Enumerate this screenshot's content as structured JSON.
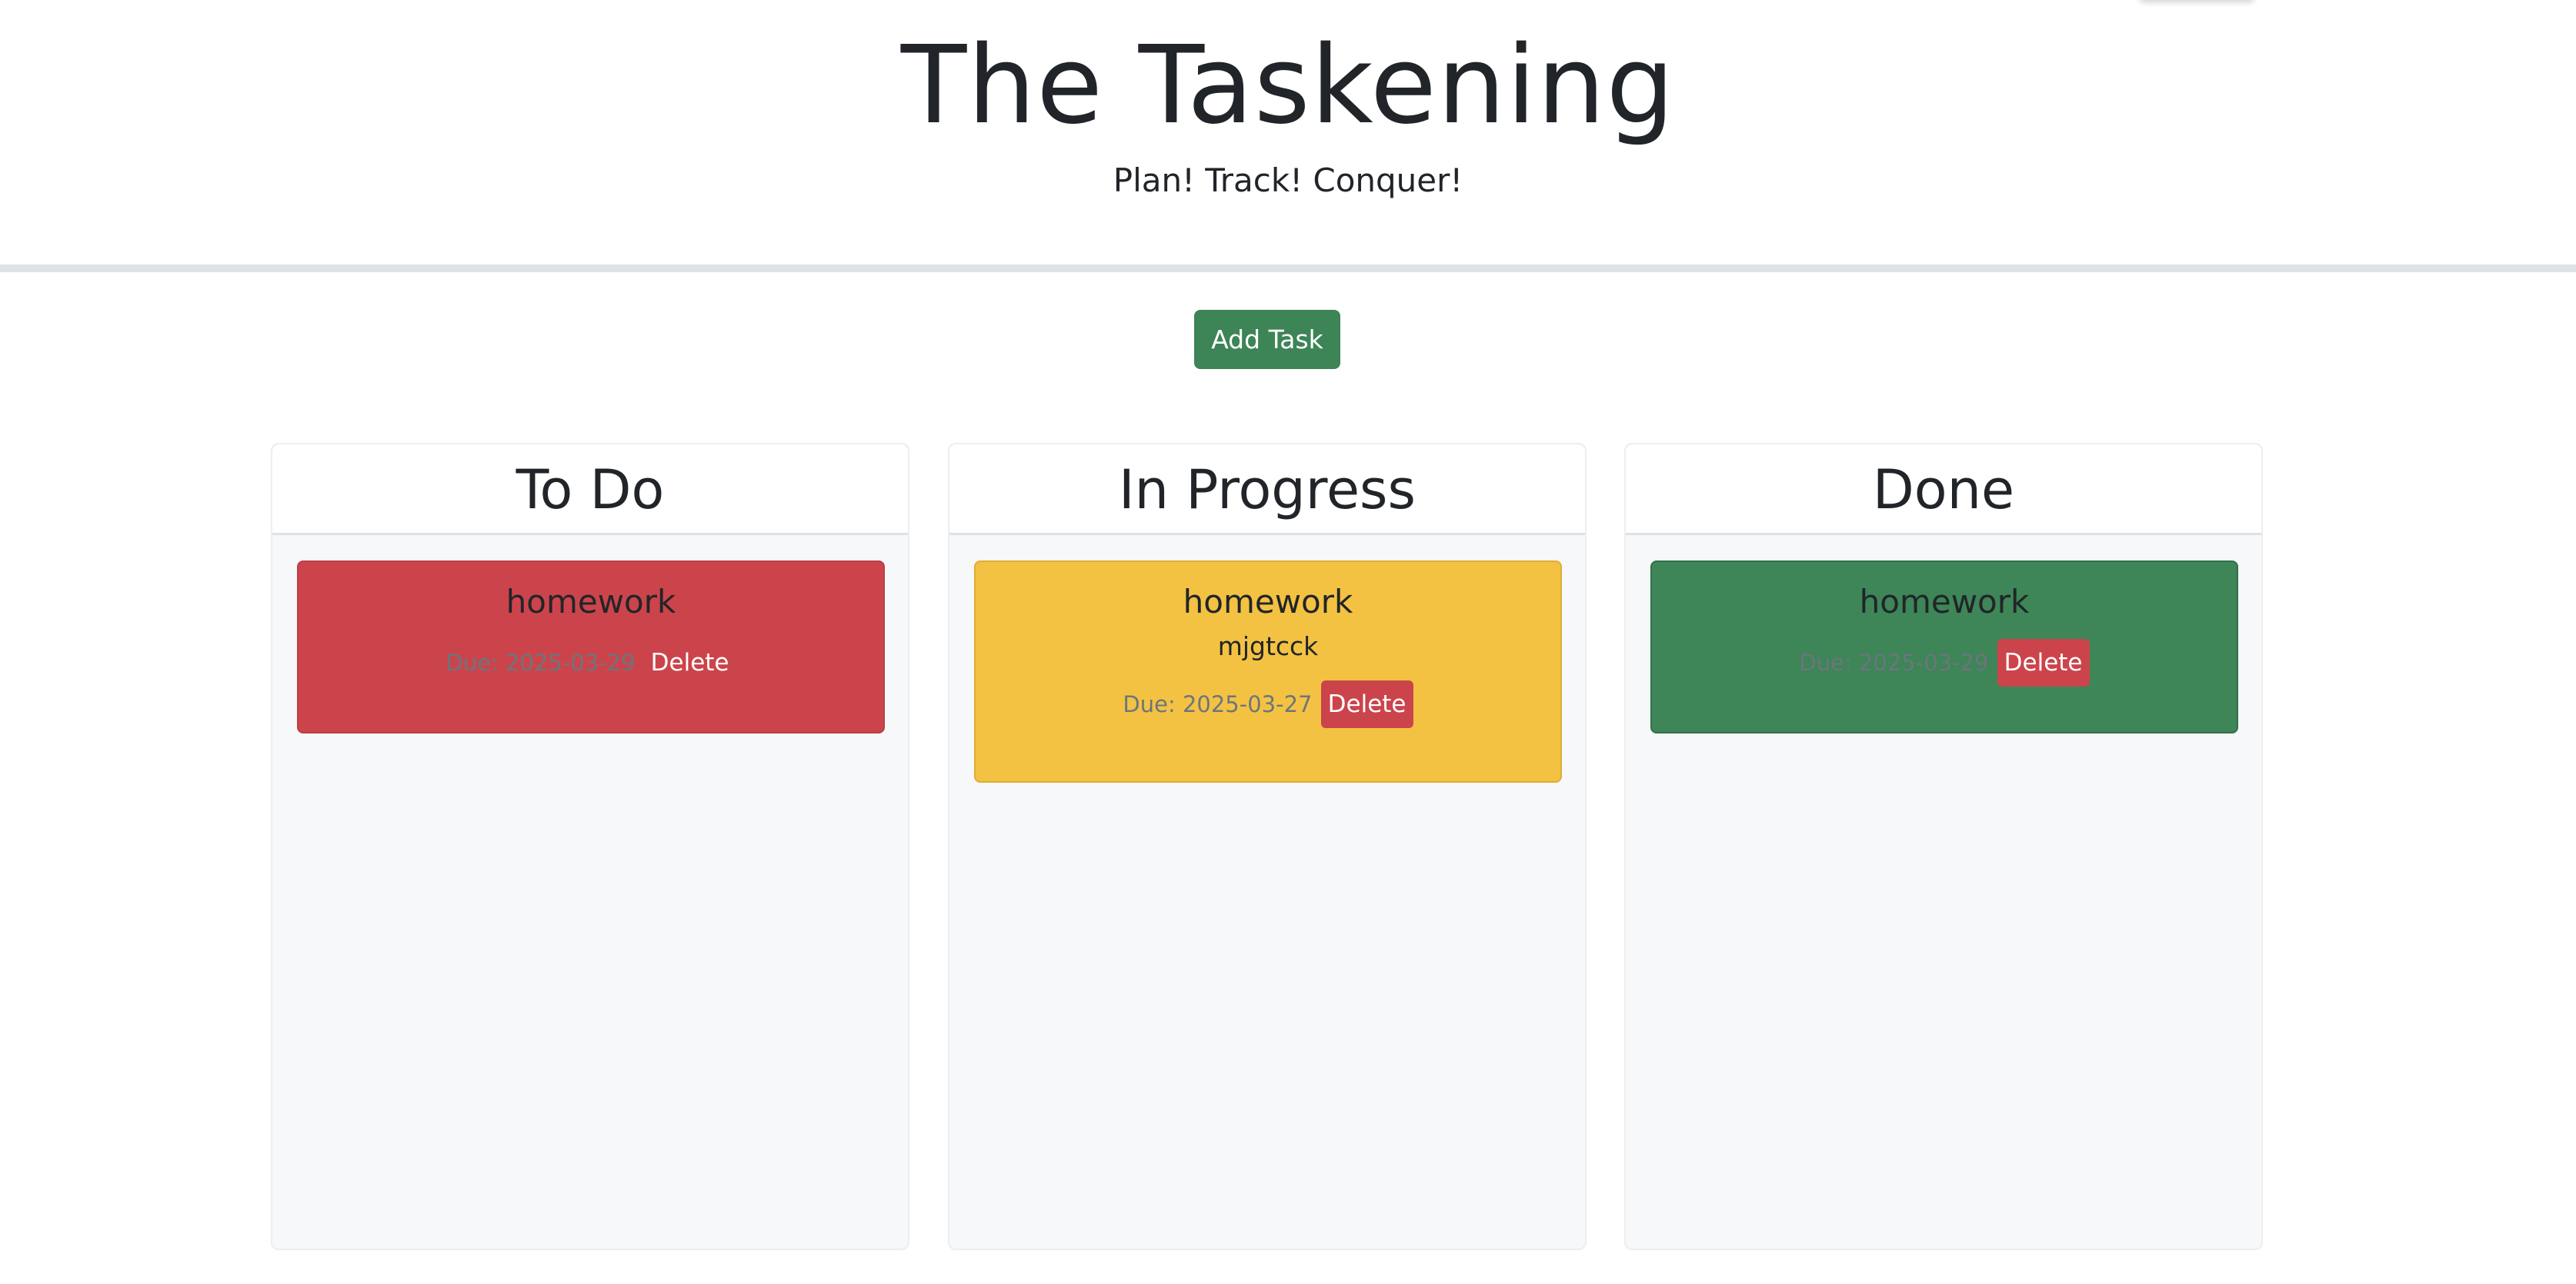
{
  "header": {
    "title": "The Taskening",
    "subtitle": "Plan! Track! Conquer!"
  },
  "toolbar": {
    "add_task_label": "Add Task"
  },
  "colors": {
    "todo_card": "#cc444b",
    "in_progress_card": "#f4c242",
    "done_card": "#3e8557",
    "add_button": "#3d8457",
    "delete_button": "#cc444b"
  },
  "lanes": {
    "todo": {
      "title": "To Do",
      "tasks": [
        {
          "title": "homework",
          "description": "",
          "due": "Due: 2025-03-29",
          "delete_label": "Delete"
        }
      ]
    },
    "in_progress": {
      "title": "In Progress",
      "tasks": [
        {
          "title": "homework",
          "description": "mjgtcck",
          "due": "Due: 2025-03-27",
          "delete_label": "Delete"
        }
      ]
    },
    "done": {
      "title": "Done",
      "tasks": [
        {
          "title": "homework",
          "description": "",
          "due": "Due: 2025-03-29",
          "delete_label": "Delete"
        }
      ]
    }
  }
}
